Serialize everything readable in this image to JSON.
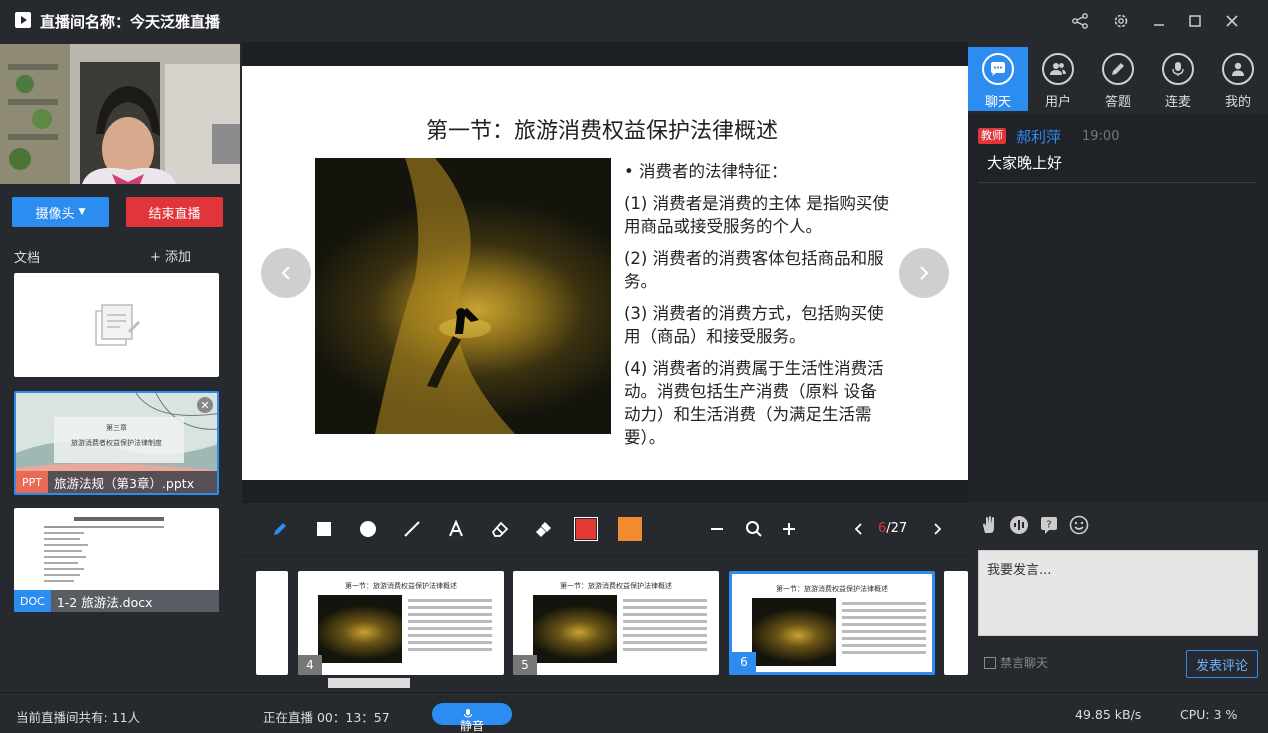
{
  "window": {
    "title": "直播间名称：今天泛雅直播"
  },
  "left": {
    "camera_button": "摄像头",
    "end_live_button": "结束直播",
    "doc_label": "文档",
    "add_label": "+ 添加",
    "docs": [
      {
        "type": "",
        "name": ""
      },
      {
        "type": "PPT",
        "name": "旅游法规（第3章）.pptx",
        "thumb_line1": "第三章",
        "thumb_line2": "旅游消费者权益保护法律制度"
      },
      {
        "type": "DOC",
        "name": "1-2 旅游法.docx"
      }
    ]
  },
  "slide": {
    "title": "第一节：旅游消费权益保护法律概述",
    "bullet": "• 消费者的法律特征：",
    "items": [
      "(1) 消费者是消费的主体 是指购买使用商品或接受服务的个人。",
      "(2) 消费者的消费客体包括商品和服务。",
      "(3) 消费者的消费方式，包括购买使用（商品）和接受服务。",
      "(4) 消费者的消费属于生活性消费活动。消费包括生产消费（原料 设备 动力）和生活消费（为满足生活需要）。"
    ]
  },
  "toolbar": {
    "pen_color": "#e53935",
    "fill_color": "#f28b30",
    "current_page": "6",
    "total_pages": "/27"
  },
  "thumbs": [
    {
      "num": "4",
      "title": "第一节：旅游消费权益保护法律概述"
    },
    {
      "num": "5",
      "title": "第一节：旅游消费权益保护法律概述"
    },
    {
      "num": "6",
      "title": "第一节：旅游消费权益保护法律概述"
    }
  ],
  "right": {
    "tabs": [
      "聊天",
      "用户",
      "答题",
      "连麦",
      "我的"
    ],
    "chat": {
      "badge": "教师",
      "user": "郝利萍",
      "time": "19:00",
      "text": "大家晚上好"
    },
    "input_placeholder": "我要发言...",
    "mute_chat_label": "禁言聊天",
    "submit_label": "发表评论"
  },
  "status": {
    "viewers": "当前直播间共有: 11人",
    "live_time": "正在直播 00：13：57",
    "mute_label": "静音",
    "bandwidth": "49.85 kB/s",
    "cpu": "CPU:  3 %"
  }
}
